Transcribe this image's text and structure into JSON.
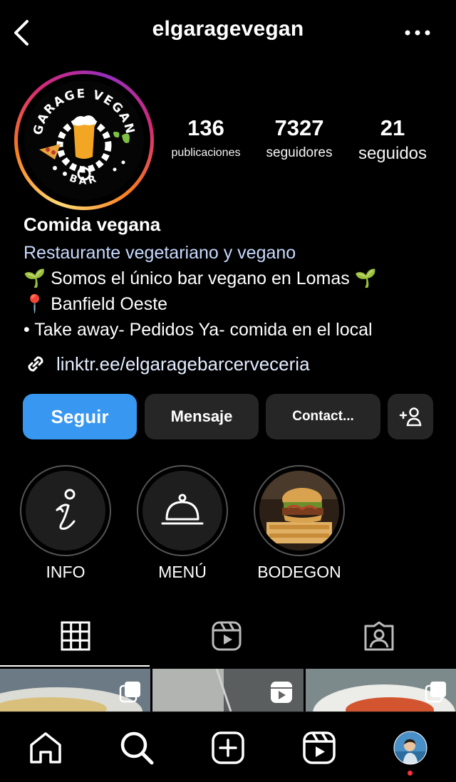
{
  "header": {
    "username": "elgaragevegan"
  },
  "profile": {
    "logo_text": {
      "top": "GARAGE VEGAN",
      "bottom": "BAR"
    },
    "stats": [
      {
        "value": "136",
        "label": "publicaciones"
      },
      {
        "value": "7327",
        "label": "seguidores"
      },
      {
        "value": "21",
        "label": "seguidos"
      }
    ],
    "name": "Comida vegana",
    "category": "Restaurante vegetariano y vegano",
    "bio_lines": [
      "🌱 Somos el único bar vegano en Lomas 🌱",
      "📍 Banfield Oeste",
      "• Take away- Pedidos Ya- comida en el local"
    ],
    "link": "linktr.ee/elgaragebarcerveceria"
  },
  "actions": {
    "follow": "Seguir",
    "message": "Mensaje",
    "contact": "Contact..."
  },
  "highlights": [
    {
      "label": "INFO",
      "icon": "info-icon"
    },
    {
      "label": "MENÚ",
      "icon": "cloche-icon"
    },
    {
      "label": "BODEGON",
      "icon": "burger-photo"
    }
  ],
  "tabs": [
    {
      "name": "grid",
      "icon": "grid-icon",
      "active": true
    },
    {
      "name": "reels",
      "icon": "reels-icon",
      "active": false
    },
    {
      "name": "tagged",
      "icon": "tagged-icon",
      "active": false
    }
  ],
  "nav": [
    {
      "name": "home",
      "icon": "home-icon"
    },
    {
      "name": "search",
      "icon": "search-icon"
    },
    {
      "name": "create",
      "icon": "plus-square-icon"
    },
    {
      "name": "reels",
      "icon": "reels-icon"
    },
    {
      "name": "profile",
      "icon": "avatar"
    }
  ],
  "colors": {
    "accent": "#3897f0",
    "button_dark": "#262626",
    "notification_dot": "#ff3040"
  }
}
